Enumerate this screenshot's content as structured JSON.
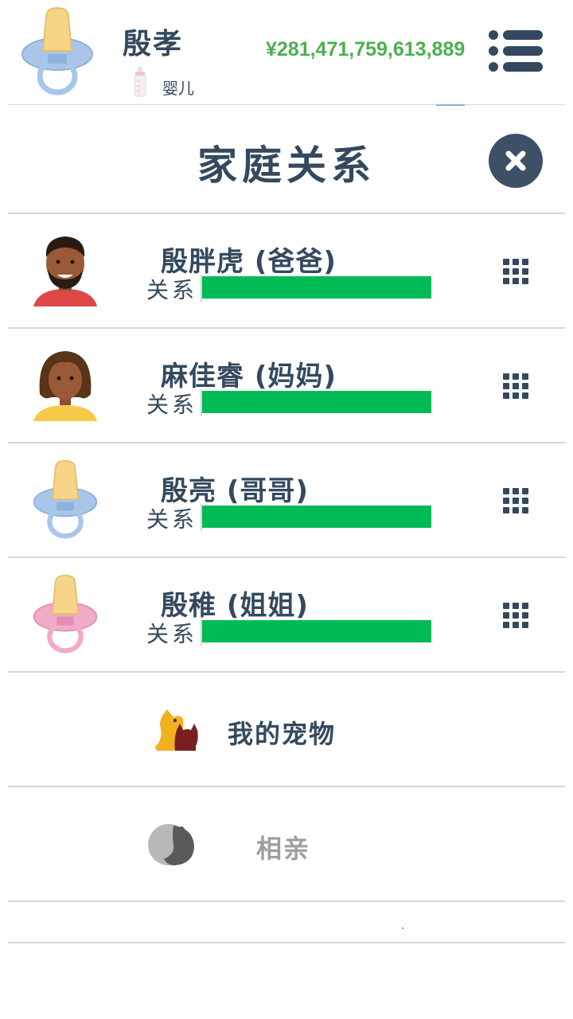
{
  "header": {
    "player_name": "殷孝",
    "life_stage": "婴儿",
    "money": "¥281,471,759,613,889",
    "avatar_icon": "blue-pacifier-icon",
    "stage_icon": "baby-bottle-icon",
    "menu_icon": "list-menu-icon"
  },
  "page": {
    "title": "家庭关系",
    "close_icon": "close-icon"
  },
  "family": [
    {
      "name": "殷胖虎 (爸爸)",
      "relation_label": "关系",
      "relation_value": 1.0,
      "avatar_icon": "dad-avatar-icon"
    },
    {
      "name": "麻佳睿 (妈妈)",
      "relation_label": "关系",
      "relation_value": 1.0,
      "avatar_icon": "mom-avatar-icon"
    },
    {
      "name": "殷亮 (哥哥)",
      "relation_label": "关系",
      "relation_value": 1.0,
      "avatar_icon": "blue-pacifier-icon"
    },
    {
      "name": "殷稚 (姐姐)",
      "relation_label": "关系",
      "relation_value": 1.0,
      "avatar_icon": "pink-pacifier-icon"
    }
  ],
  "options": {
    "pets": {
      "label": "我的宠物",
      "icon": "dog-cat-icon"
    },
    "dating": {
      "label": "相亲",
      "icon": "couple-kiss-icon",
      "enabled": false
    }
  },
  "colors": {
    "primary": "#34495e",
    "money": "#4caf50",
    "relation_bar": "#00bb55",
    "disabled": "#9e9e9e"
  }
}
